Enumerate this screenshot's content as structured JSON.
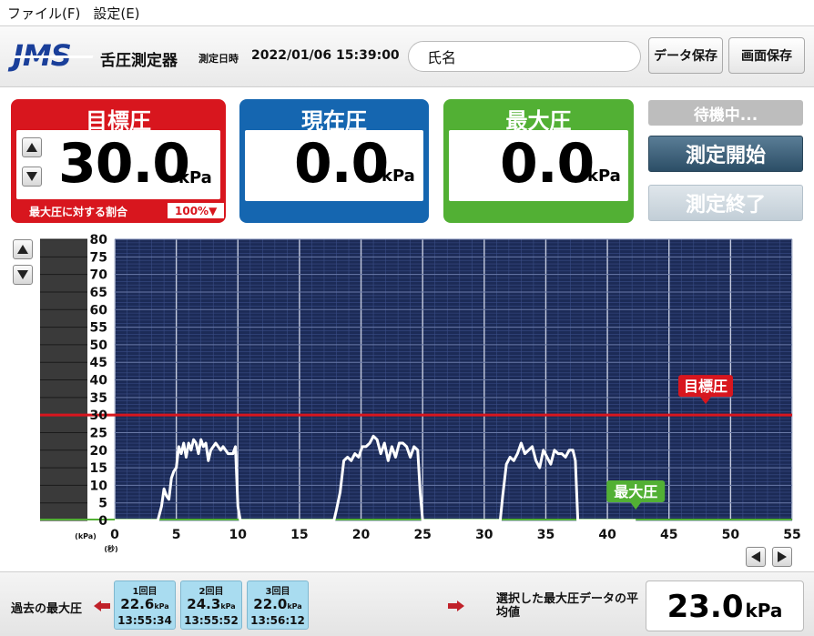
{
  "menu": {
    "file": "ファイル(F)",
    "settings": "設定(E)"
  },
  "header": {
    "logo": "JMS",
    "app_title": "舌圧測定器",
    "datetime_label": "測定日時",
    "datetime_value": "2022/01/06 15:39:00",
    "name_field": "氏名",
    "save_data_label": "データ保存",
    "save_screen_label": "画面保存"
  },
  "panels": {
    "target": {
      "title": "目標圧",
      "value": "30.0",
      "unit": "kPa",
      "ratio_label": "最大圧に対する割合",
      "ratio_value": "100%▼"
    },
    "current": {
      "title": "現在圧",
      "value": "0.0",
      "unit": "kPa"
    },
    "max": {
      "title": "最大圧",
      "value": "0.0",
      "unit": "kPa"
    }
  },
  "controls": {
    "status": "待機中...",
    "start_label": "測定開始",
    "stop_label": "測定終了"
  },
  "colors": {
    "target_red": "#d8161e",
    "current_blue": "#1566b0",
    "max_green": "#52b034",
    "plot_bg": "#1c2b57"
  },
  "icons": {
    "up": "triangle-up-icon",
    "down": "triangle-down-icon",
    "left": "triangle-left-icon",
    "right": "triangle-right-icon",
    "arrow": "red-arrow-icon"
  },
  "chart_data": {
    "type": "line",
    "xlabel": "(秒)",
    "ylabel": "(kPa)",
    "xlim": [
      0,
      55
    ],
    "ylim": [
      0,
      80
    ],
    "x_ticks": [
      0,
      5,
      10,
      15,
      20,
      25,
      30,
      35,
      40,
      45,
      50,
      55
    ],
    "y_ticks": [
      0,
      5,
      10,
      15,
      20,
      25,
      30,
      35,
      40,
      45,
      50,
      55,
      60,
      65,
      70,
      75,
      80
    ],
    "target_line": {
      "label": "目標圧",
      "y": 30
    },
    "max_marker": {
      "label": "最大圧",
      "x": 42.3
    },
    "grid": true,
    "series": [
      {
        "x": [
          0,
          3.5,
          3.8,
          4.0,
          4.2,
          4.4,
          4.6,
          4.8,
          5.0,
          5.2,
          5.4,
          5.6,
          5.8,
          6.0,
          6.2,
          6.4,
          6.6,
          6.8,
          7.0,
          7.2,
          7.4,
          7.6,
          7.8,
          8.0,
          8.2,
          8.4,
          8.6,
          8.8,
          9.0,
          9.2,
          9.4,
          9.6,
          9.8,
          10.0,
          10.2,
          17.8,
          18.0,
          18.3,
          18.6,
          18.9,
          19.2,
          19.5,
          19.8,
          20.1,
          20.4,
          20.7,
          21.0,
          21.3,
          21.6,
          21.9,
          22.2,
          22.5,
          22.8,
          23.1,
          23.4,
          23.7,
          24.0,
          24.3,
          24.6,
          24.8,
          25.0,
          31.3,
          31.5,
          31.8,
          32.1,
          32.4,
          32.7,
          33.0,
          33.3,
          33.6,
          33.9,
          34.2,
          34.5,
          34.8,
          35.1,
          35.4,
          35.7,
          36.0,
          36.3,
          36.6,
          36.9,
          37.2,
          37.4,
          37.6,
          42.3
        ],
        "values": [
          0,
          0,
          4,
          9,
          7,
          6,
          12,
          14,
          15,
          21,
          19,
          22,
          18,
          22,
          20,
          23,
          22,
          19,
          23,
          21,
          22,
          17,
          20,
          21,
          22,
          21,
          20,
          21,
          20,
          19,
          19,
          19,
          21,
          4,
          0,
          0,
          3,
          8,
          17,
          18,
          17,
          19,
          18,
          21,
          21,
          22,
          24,
          23,
          19,
          22,
          17,
          21,
          18,
          22,
          22,
          21,
          18,
          21,
          20,
          8,
          0,
          0,
          7,
          16,
          18,
          17,
          19,
          22,
          19,
          20,
          21,
          17,
          15,
          20,
          18,
          16,
          20,
          19,
          19,
          18,
          20,
          20,
          17,
          0,
          0
        ]
      }
    ]
  },
  "footer": {
    "past_label": "過去の最大圧",
    "history": [
      {
        "label": "1回目",
        "value": "22.6",
        "unit": "kPa",
        "time": "13:55:34"
      },
      {
        "label": "2回目",
        "value": "24.3",
        "unit": "kPa",
        "time": "13:55:52"
      },
      {
        "label": "3回目",
        "value": "22.0",
        "unit": "kPa",
        "time": "13:56:12"
      }
    ],
    "selected_label": "選択した最大圧データの平均値",
    "average_value": "23.0",
    "average_unit": "kPa"
  }
}
